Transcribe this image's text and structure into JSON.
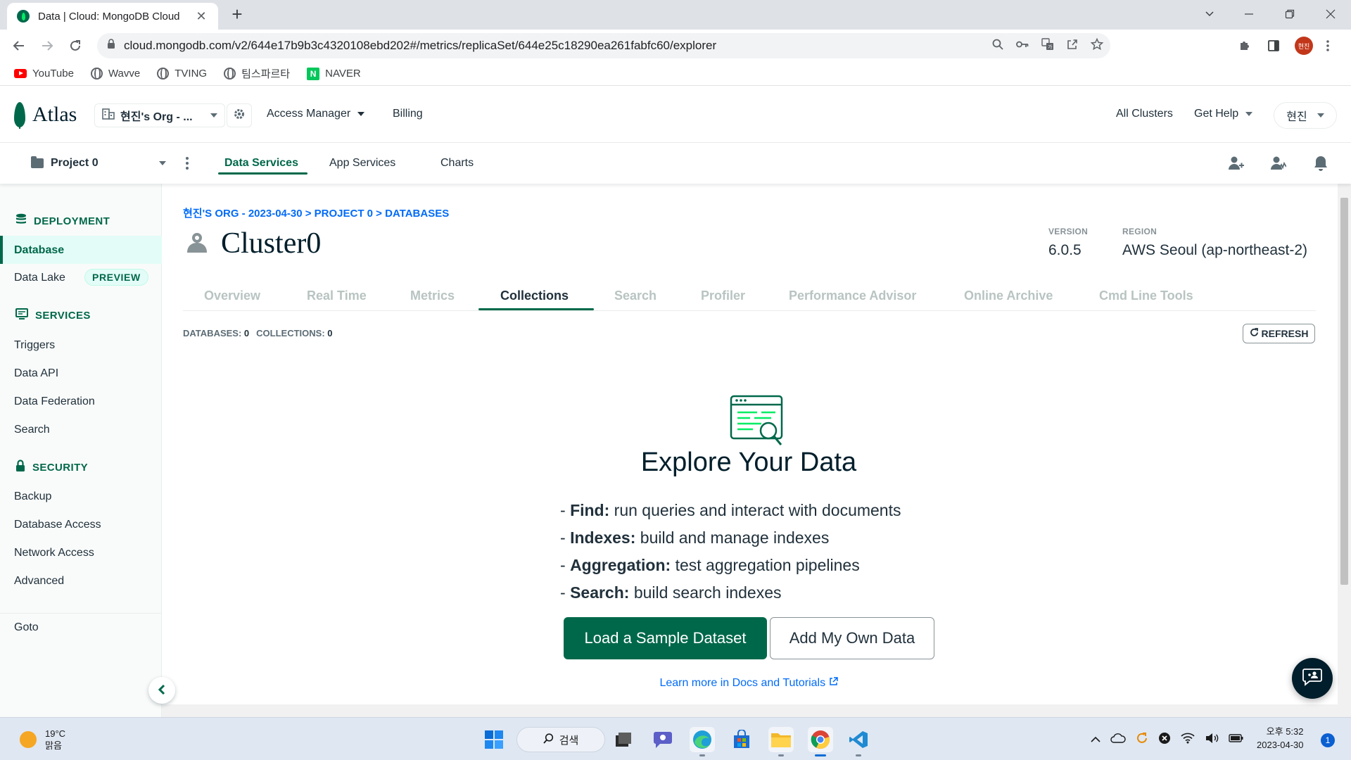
{
  "browser": {
    "tab_title": "Data | Cloud: MongoDB Cloud",
    "tab_close": "✕",
    "new_tab": "+",
    "url": "cloud.mongodb.com/v2/644e17b9b3c4320108ebd202#/metrics/replicaSet/644e25c18290ea261fabfc60/explorer",
    "profile_initials": "현진",
    "bookmarks": [
      {
        "label": "YouTube",
        "icon": "youtube-icon"
      },
      {
        "label": "Wavve",
        "icon": "globe-icon"
      },
      {
        "label": "TVING",
        "icon": "globe-icon"
      },
      {
        "label": "팀스파르타",
        "icon": "globe-icon"
      },
      {
        "label": "NAVER",
        "icon": "naver-icon"
      }
    ]
  },
  "atlas": {
    "brand": "Atlas",
    "org": "현진's Org - ...",
    "top_links": {
      "access_manager": "Access Manager",
      "billing": "Billing",
      "all_clusters": "All Clusters",
      "get_help": "Get Help",
      "user": "현진"
    },
    "project": "Project 0",
    "nav_tabs": [
      "Data Services",
      "App Services",
      "Charts"
    ],
    "active_nav_tab": "Data Services"
  },
  "sidebar": {
    "deployment": {
      "title": "DEPLOYMENT",
      "items": [
        "Database",
        "Data Lake"
      ]
    },
    "preview_badge": "PREVIEW",
    "services": {
      "title": "SERVICES",
      "items": [
        "Triggers",
        "Data API",
        "Data Federation",
        "Search"
      ]
    },
    "security": {
      "title": "SECURITY",
      "items": [
        "Backup",
        "Database Access",
        "Network Access",
        "Advanced"
      ]
    },
    "goto": "Goto",
    "active_item": "Database"
  },
  "main": {
    "breadcrumb": "현진'S ORG - 2023-04-30 > PROJECT 0 > DATABASES",
    "cluster_name": "Cluster0",
    "version_label": "VERSION",
    "version": "6.0.5",
    "region_label": "REGION",
    "region": "AWS Seoul (ap-northeast-2)",
    "tabs": [
      "Overview",
      "Real Time",
      "Metrics",
      "Collections",
      "Search",
      "Profiler",
      "Performance Advisor",
      "Online Archive",
      "Cmd Line Tools"
    ],
    "active_tab": "Collections",
    "databases_label": "DATABASES:",
    "databases_count": "0",
    "collections_label": "COLLECTIONS:",
    "collections_count": "0",
    "refresh": "REFRESH",
    "explore_title": "Explore Your Data",
    "features": [
      {
        "name": "Find:",
        "text": "run queries and interact with documents"
      },
      {
        "name": "Indexes:",
        "text": "build and manage indexes"
      },
      {
        "name": "Aggregation:",
        "text": "test aggregation pipelines"
      },
      {
        "name": "Search:",
        "text": "build search indexes"
      }
    ],
    "load_sample": "Load a Sample Dataset",
    "add_own_data": "Add My Own Data",
    "learn_more": "Learn more in Docs and Tutorials"
  },
  "taskbar": {
    "temperature": "19°C",
    "weather": "맑음",
    "search": "검색",
    "time": "오후 5:32",
    "date": "2023-04-30",
    "notifications": "1"
  },
  "colors": {
    "brand_green": "#00684a",
    "link_blue": "#016bf8",
    "text_dark": "#21313c"
  }
}
